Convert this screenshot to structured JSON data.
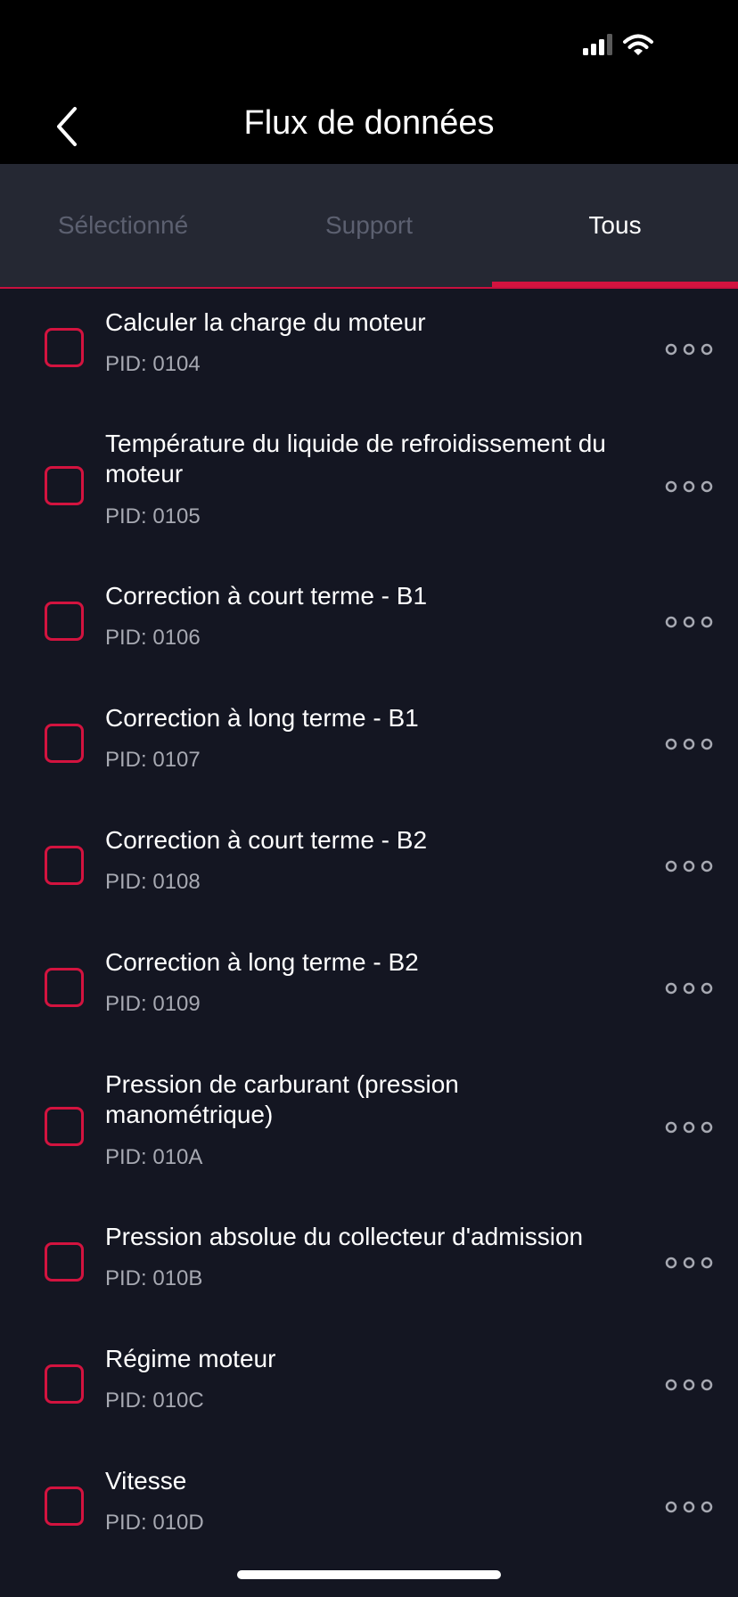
{
  "header": {
    "title": "Flux de données",
    "back_icon": "chevron-left-icon"
  },
  "status_bar": {
    "icons": [
      "cellular-signal-icon",
      "wifi-icon"
    ]
  },
  "tabs": [
    {
      "label": "Sélectionné",
      "active": false
    },
    {
      "label": "Support",
      "active": false
    },
    {
      "label": "Tous",
      "active": true
    }
  ],
  "items": [
    {
      "name": "Calculer la charge du moteur",
      "pid": "PID: 0104",
      "checked": false
    },
    {
      "name": "Température du liquide de refroidissement du moteur",
      "pid": "PID: 0105",
      "checked": false
    },
    {
      "name": "Correction à court terme - B1",
      "pid": "PID: 0106",
      "checked": false
    },
    {
      "name": "Correction à long terme - B1",
      "pid": "PID: 0107",
      "checked": false
    },
    {
      "name": "Correction à court terme - B2",
      "pid": "PID: 0108",
      "checked": false
    },
    {
      "name": "Correction à long terme - B2",
      "pid": "PID: 0109",
      "checked": false
    },
    {
      "name": "Pression de carburant (pression manométrique)",
      "pid": "PID: 010A",
      "checked": false
    },
    {
      "name": "Pression absolue du collecteur d'admission",
      "pid": "PID: 010B",
      "checked": false
    },
    {
      "name": "Régime moteur",
      "pid": "PID: 010C",
      "checked": false
    },
    {
      "name": "Vitesse",
      "pid": "PID: 010D",
      "checked": false
    }
  ],
  "colors": {
    "accent": "#d3133f",
    "background": "#141622",
    "tab_bar": "#252833",
    "header": "#000000",
    "secondary_text": "#a7a9b2",
    "inactive_tab": "#5c6070"
  }
}
